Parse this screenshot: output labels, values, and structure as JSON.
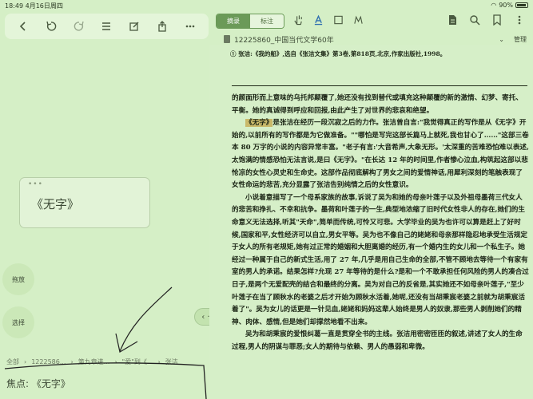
{
  "status_bar": {
    "time": "18:49",
    "date": "4月16日周四",
    "battery": "90%"
  },
  "left_toolbar": {
    "icons": [
      "back-icon",
      "undo-icon",
      "redo-icon",
      "list-icon",
      "edit-icon",
      "share-icon",
      "more-icon"
    ]
  },
  "focus_card": {
    "text": "《无字》"
  },
  "side_buttons": {
    "drag": "拖放",
    "select": "选择"
  },
  "breadcrumb": {
    "items": [
      "全部",
      "1222586...",
      "第九章进...",
      "\"爱\"到《...",
      "张洁"
    ]
  },
  "focus_line": "焦点: 《无字》",
  "right_toolbar": {
    "tabs": [
      {
        "label": "摘录",
        "active": true
      },
      {
        "label": "标注",
        "active": false
      }
    ],
    "tool_icons": [
      "hand-icon",
      "text-select-icon",
      "rect-select-icon",
      "lasso-icon"
    ],
    "right_icons": [
      "document-icon",
      "search-icon",
      "bookmark-icon",
      "more-vertical-icon"
    ]
  },
  "file_bar": {
    "name": "12225860_中国当代文学60年",
    "manage": "管理"
  },
  "document": {
    "header": "① 张洁:《我的船》,选自《张洁文集》第3卷,第818页,北京,作家出版社,1998。",
    "paragraphs": [
      {
        "indent": false,
        "text": "的颜面形而上意味的乌托邦颠覆了,她还没有找到替代或填充这种颠覆的新的激情、幻梦、寄托、平衡。她的真诚得到呼应和回报,由此产生了对世界的悲哀和绝望。"
      },
      {
        "indent": true,
        "text": "是张洁在经历一段沉寂之后的力作。张洁曾自言:\"我觉得真正的写作是从《无字》开始的,以前所有的写作都是为它做准备。\"\"哪怕是写完这部长篇马上就死,我也甘心了……\"这部三卷本 80 万字的小说的内容异常丰富。\"老子有言:'大音希声,大象无形。'太深重的苦难恐怕难以表述,太饱满的情感恐怕无法言说,是曰《无字》。\"在长达 12 年的时间里,作者惨心泣血,构筑起这部以悲怆凉的女性心灵史和生命史。这部作品彻底解构了男女之间的爱情神话,用犀利深刻的笔触表现了女性命运的悲苦,充分显露了张洁告别纯情之后的女性意识。"
      },
      {
        "indent": true,
        "text": "小说着意描写了一个母系家族的故事,诉说了吴为和她的母亲叶莲子以及外祖母墨荷三代女人的悲苦和挣扎、不幸和抗争。墨荷和叶莲子的一生,典型地浓缩了旧时代女性非人的存在,她们的生命意义无法选择,听其\"天命\",简单而传统,可怜又可悲。大学毕业的吴为也许可以算是赶上了好时候,国家和平,女性经济可以自立,男女平等。吴为也不像自己的姥姥和母亲那样隐忍地承受生活规定于女人的所有老规矩,她有过正常的婚姻和大胆离婚的经历,有一个婚内生的女儿和一个私生子。她经过一种属于自己的新式生活,用了 27 年,几乎是用自己生命的全部,不管不顾地去等待一个有家有室的男人的承诺。结果怎样?允现 27 年等待的是什么?是和一个不敢承担任何风险的男人的凑合过日子,是两个无爱配壳的结合和最终的分离。吴为对自己的反省是,其实她还不如母亲叶莲子,\"至少叶莲子在当了顾秋水的老婆之后才开始为顾秋水活着,她呢,还没有当胡秉宸老婆之前就为胡秉宸活着了\"。吴为女儿的话更是一针见血,姥姥和妈妈这辈人始终是男人的奴隶,那些男人剥削她们的精神、肉体、感情,但是她们却撑然地看不出来。"
      },
      {
        "indent": true,
        "text": "吴为和胡秉宸的爱恨纠葛一直是贯穿全书的主线。张洁用密密匝匝的叙述,讲述了女人的生命过程,男人的阴谋与罪恶;女人的期待与依赖、男人的愚弱和卑微。"
      }
    ],
    "highlight": "《无字》"
  }
}
